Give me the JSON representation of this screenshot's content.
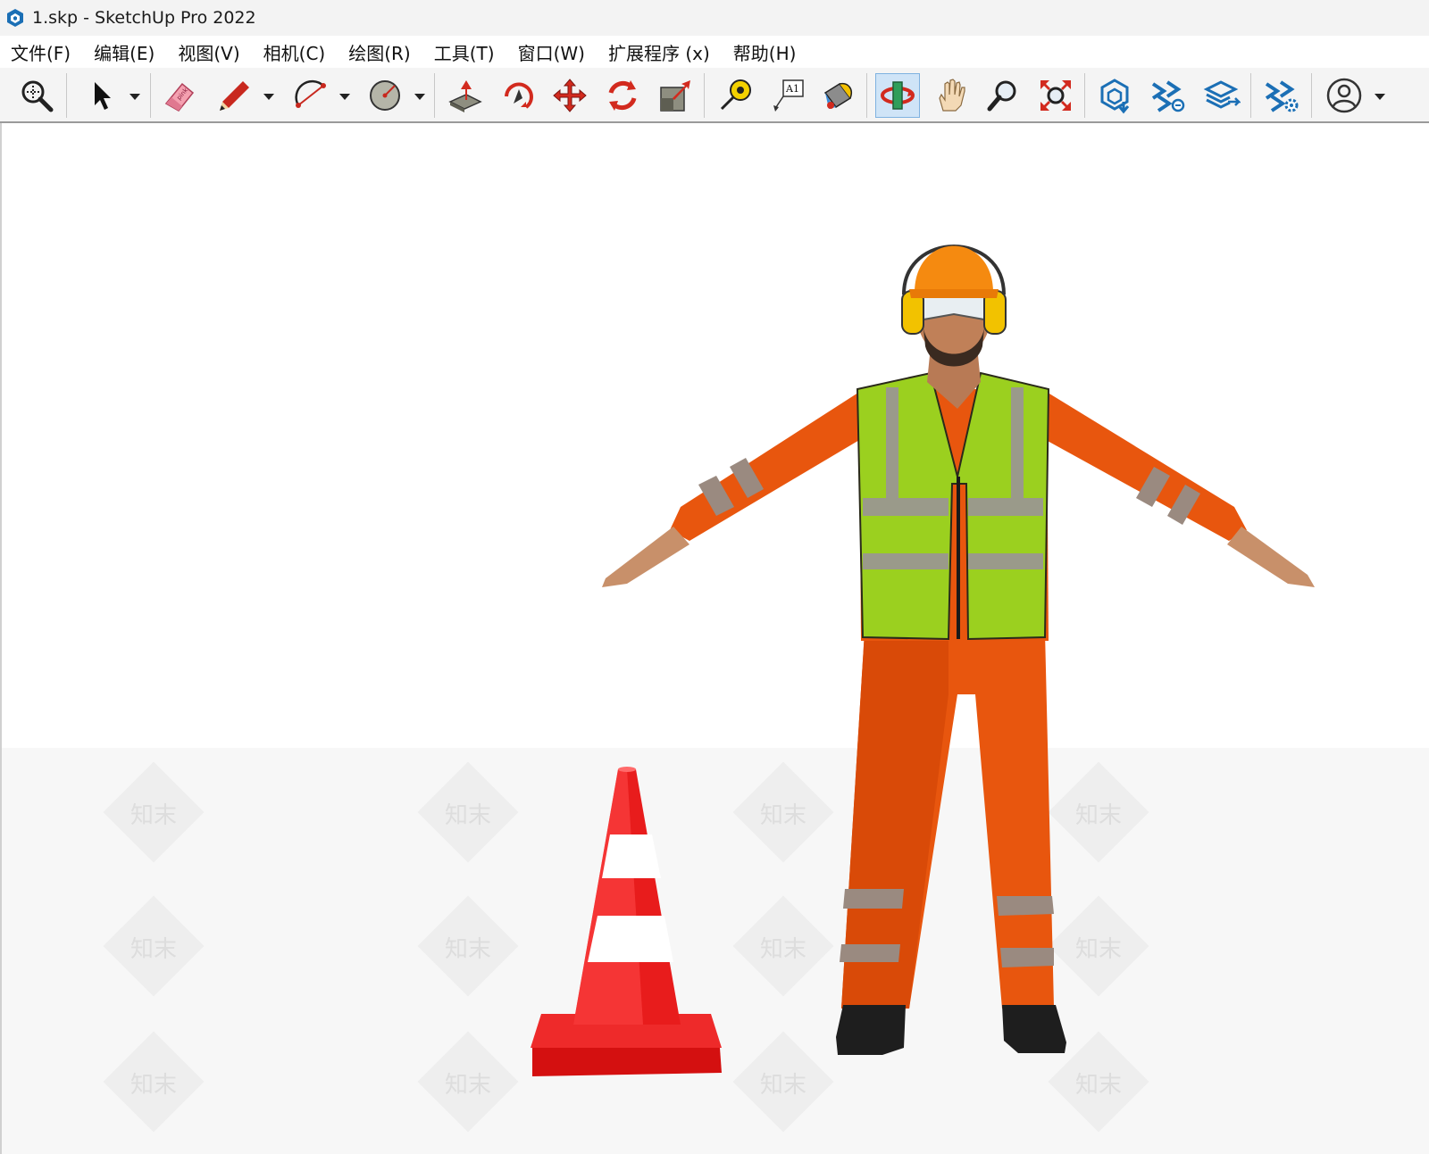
{
  "window": {
    "title": "1.skp - SketchUp Pro 2022"
  },
  "menu": {
    "items": [
      "文件(F)",
      "编辑(E)",
      "视图(V)",
      "相机(C)",
      "绘图(R)",
      "工具(T)",
      "窗口(W)",
      "扩展程序 (x)",
      "帮助(H)"
    ]
  },
  "toolbar": {
    "tools": [
      "zoom-window-icon",
      "select-icon",
      "eraser-icon",
      "pencil-icon",
      "arc-icon",
      "circle-icon",
      "push-pull-icon",
      "follow-me-icon",
      "move-icon",
      "rotate-icon",
      "scale-icon",
      "tape-measure-icon",
      "text-icon",
      "paint-bucket-icon",
      "orbit-icon",
      "pan-icon",
      "zoom-icon",
      "zoom-extents-icon",
      "warehouse-icon",
      "extension-warehouse-icon",
      "layout-send-icon",
      "extension-manager-icon",
      "account-icon"
    ],
    "text_tool_label": "A1",
    "eraser_label": "pink",
    "active_tool": "orbit-icon"
  },
  "viewport": {
    "watermark": "知末",
    "scene_objects": [
      "traffic-cone",
      "construction-worker"
    ],
    "colors": {
      "ground": "#f7f7f7",
      "vest": "#9bd01f",
      "coverall": "#e8560e",
      "cone": "#e01818"
    }
  }
}
